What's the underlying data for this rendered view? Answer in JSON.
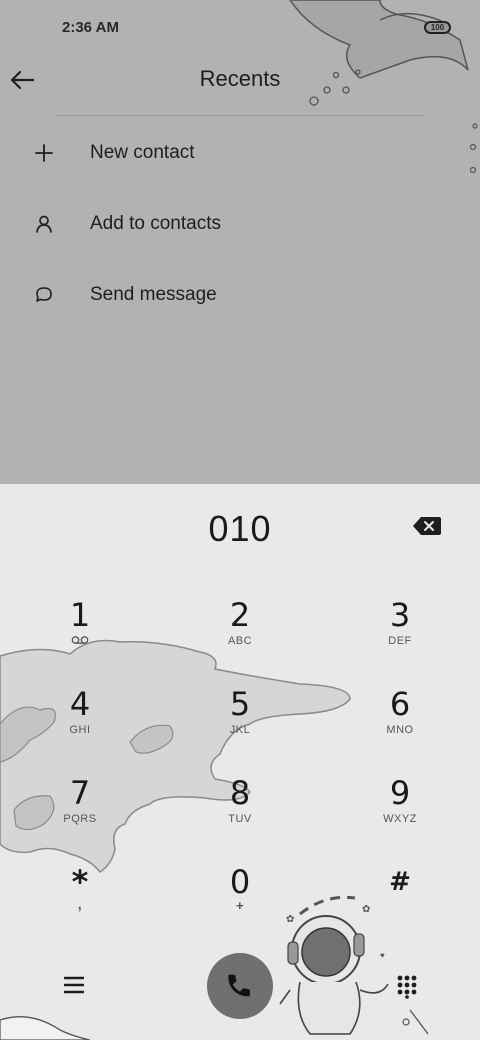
{
  "status_bar": {
    "time": "2:36 AM",
    "battery": "100"
  },
  "header": {
    "title": "Recents",
    "back_icon": "arrow-left-icon"
  },
  "menu": [
    {
      "label": "New contact",
      "icon": "plus-icon"
    },
    {
      "label": "Add to contacts",
      "icon": "person-icon"
    },
    {
      "label": "Send message",
      "icon": "chat-bubble-icon"
    }
  ],
  "dialer": {
    "number": "010",
    "keys": [
      {
        "digit": "1",
        "letters": "voicemail"
      },
      {
        "digit": "2",
        "letters": "ABC"
      },
      {
        "digit": "3",
        "letters": "DEF"
      },
      {
        "digit": "4",
        "letters": "GHI"
      },
      {
        "digit": "5",
        "letters": "JKL"
      },
      {
        "digit": "6",
        "letters": "MNO"
      },
      {
        "digit": "7",
        "letters": "PQRS"
      },
      {
        "digit": "8",
        "letters": "TUV"
      },
      {
        "digit": "9",
        "letters": "WXYZ"
      },
      {
        "digit": "*",
        "letters": ","
      },
      {
        "digit": "0",
        "letters": "+"
      },
      {
        "digit": "#",
        "letters": ""
      }
    ]
  },
  "bottom_bar": {
    "menu_icon": "hamburger-menu-icon",
    "call_icon": "phone-icon",
    "keypad_icon": "dialpad-icon"
  },
  "colors": {
    "top_background": "#b2b2b2",
    "dialer_background": "#e9e9e9",
    "call_button": "#6f6f6f"
  }
}
